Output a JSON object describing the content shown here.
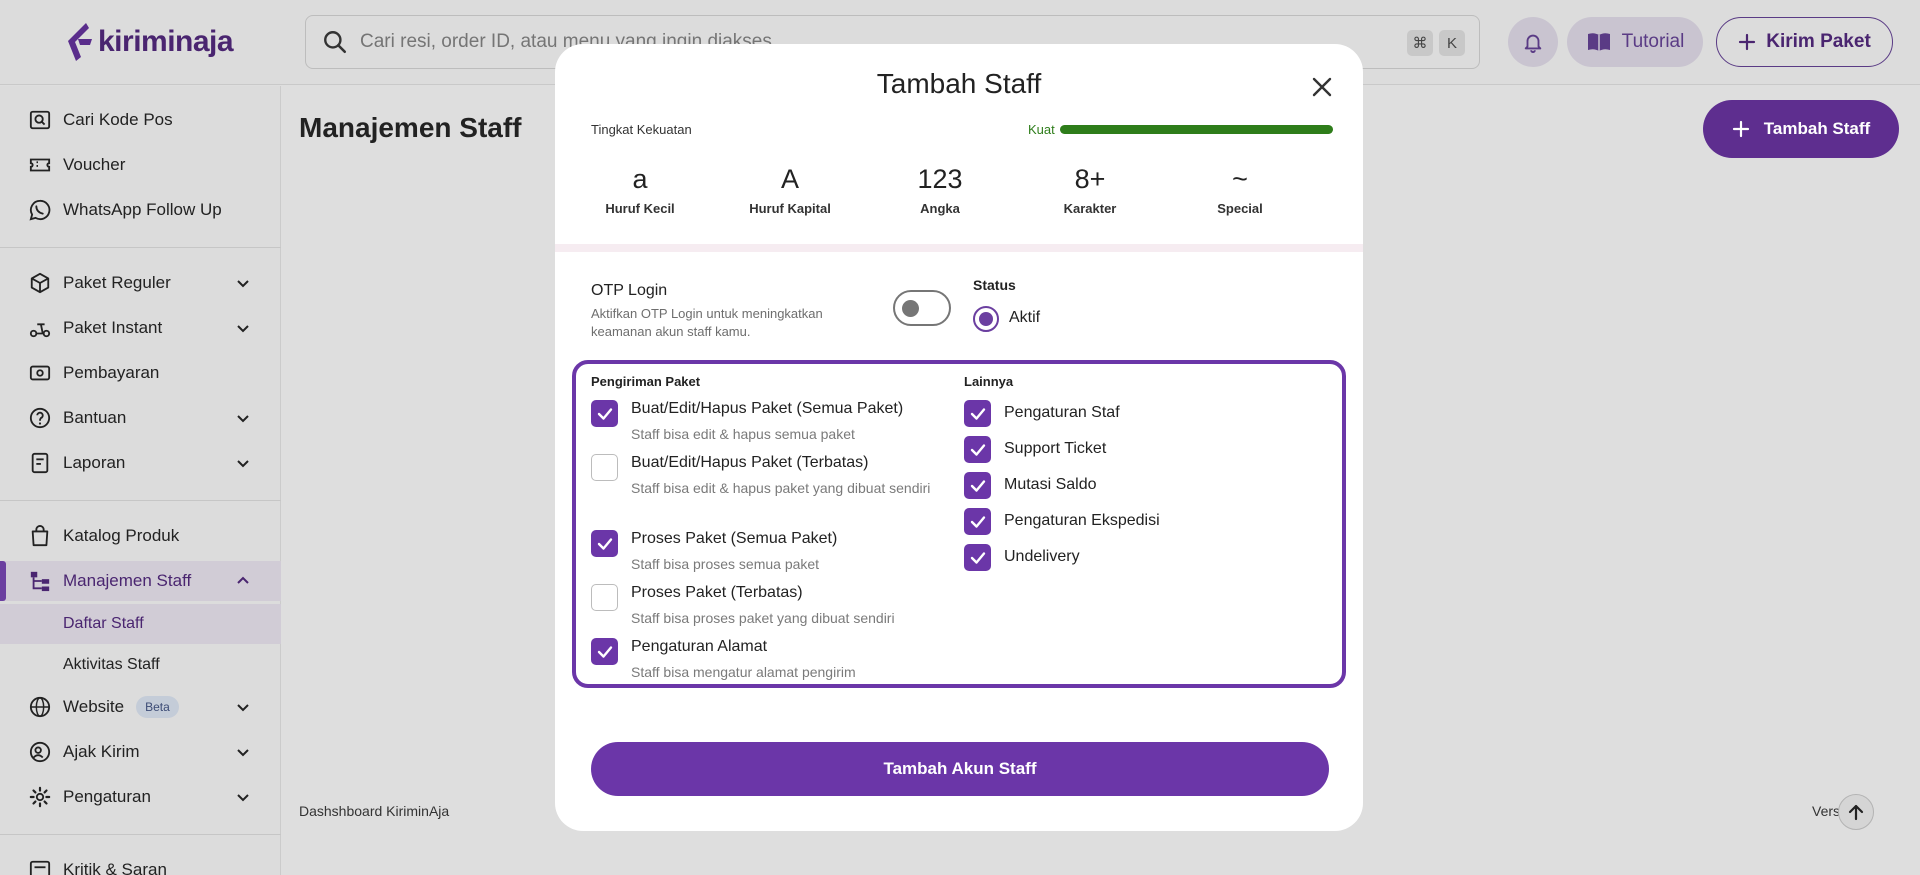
{
  "brand": {
    "name": "kiriminaja",
    "color": "#6b36a8"
  },
  "header": {
    "search_placeholder": "Cari resi, order ID, atau menu yang ingin diakses",
    "shortcut_keys": [
      "⌘",
      "K"
    ],
    "tutorial_label": "Tutorial",
    "kirim_paket_label": "Kirim Paket"
  },
  "sidebar": {
    "items": [
      {
        "label": "Cari Kode Pos",
        "icon": "search-postcode-icon"
      },
      {
        "label": "Voucher",
        "icon": "voucher-icon"
      },
      {
        "label": "WhatsApp Follow Up",
        "icon": "whatsapp-icon"
      },
      {
        "label": "Paket Reguler",
        "icon": "package-icon"
      },
      {
        "label": "Paket Instant",
        "icon": "scooter-icon"
      },
      {
        "label": "Pembayaran",
        "icon": "payment-icon"
      },
      {
        "label": "Bantuan",
        "icon": "help-icon"
      },
      {
        "label": "Laporan",
        "icon": "report-icon"
      },
      {
        "label": "Katalog Produk",
        "icon": "bag-icon"
      },
      {
        "label": "Manajemen Staff",
        "icon": "org-chart-icon"
      },
      {
        "label": "Daftar Staff"
      },
      {
        "label": "Aktivitas Staff"
      },
      {
        "label": "Website",
        "icon": "globe-icon",
        "badge": "Beta"
      },
      {
        "label": "Ajak Kirim",
        "icon": "referral-icon"
      },
      {
        "label": "Pengaturan",
        "icon": "gear-icon"
      },
      {
        "label": "Kritik & Saran",
        "icon": "feedback-icon"
      }
    ]
  },
  "main": {
    "page_title": "Manajemen Staff",
    "add_staff_label": "Tambah Staff",
    "footer_left": "Dashshboard KiriminAja",
    "footer_right": "Vers   2.39"
  },
  "modal": {
    "title": "Tambah Staff",
    "strength": {
      "label": "Tingkat Kekuatan",
      "word": "Kuat",
      "level_percent": 100
    },
    "requirements": [
      {
        "symbol": "a",
        "label": "Huruf Kecil"
      },
      {
        "symbol": "A",
        "label": "Huruf Kapital"
      },
      {
        "symbol": "123",
        "label": "Angka"
      },
      {
        "symbol": "8+",
        "label": "Karakter"
      },
      {
        "symbol": "~",
        "label": "Special"
      }
    ],
    "otp": {
      "title": "OTP Login",
      "description": "Aktifkan OTP Login untuk meningkatkan keamanan akun staff kamu.",
      "enabled": false
    },
    "status": {
      "title": "Status",
      "selected": "Aktif"
    },
    "permissions": {
      "left_heading": "Pengiriman Paket",
      "right_heading": "Lainnya",
      "left": [
        {
          "title": "Buat/Edit/Hapus Paket (Semua Paket)",
          "desc": "Staff bisa edit & hapus semua paket",
          "checked": true
        },
        {
          "title": "Buat/Edit/Hapus Paket (Terbatas)",
          "desc": "Staff bisa edit & hapus paket yang dibuat sendiri",
          "checked": false
        },
        {
          "title": "Proses Paket (Semua Paket)",
          "desc": "Staff bisa proses semua paket",
          "checked": true
        },
        {
          "title": "Proses Paket (Terbatas)",
          "desc": "Staff bisa proses paket yang dibuat sendiri",
          "checked": false
        },
        {
          "title": "Pengaturan Alamat",
          "desc": "Staff bisa mengatur alamat pengirim",
          "checked": true
        }
      ],
      "right": [
        {
          "title": "Pengaturan Staf",
          "checked": true
        },
        {
          "title": "Support Ticket",
          "checked": true
        },
        {
          "title": "Mutasi Saldo",
          "checked": true
        },
        {
          "title": "Pengaturan Ekspedisi",
          "checked": true
        },
        {
          "title": "Undelivery",
          "checked": true
        }
      ]
    },
    "submit_label": "Tambah Akun Staff"
  }
}
